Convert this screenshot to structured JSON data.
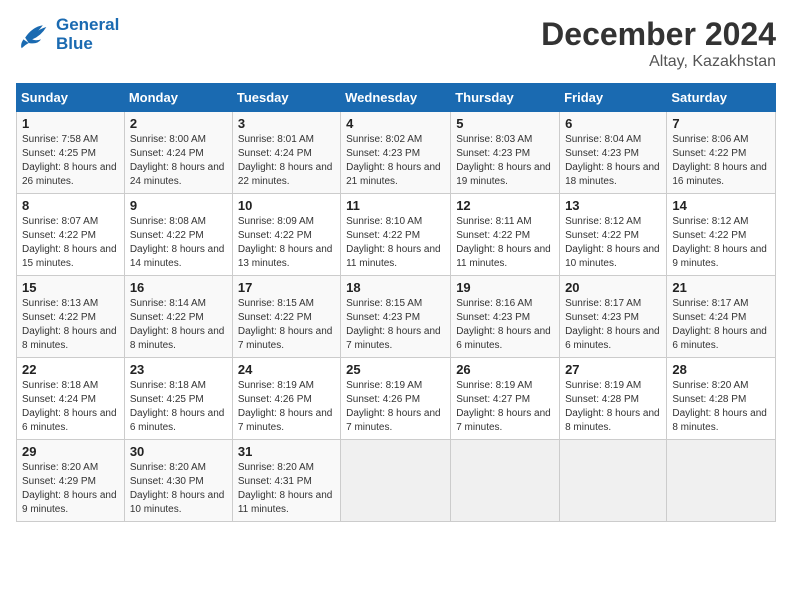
{
  "header": {
    "logo_line1": "General",
    "logo_line2": "Blue",
    "month": "December 2024",
    "location": "Altay, Kazakhstan"
  },
  "weekdays": [
    "Sunday",
    "Monday",
    "Tuesday",
    "Wednesday",
    "Thursday",
    "Friday",
    "Saturday"
  ],
  "weeks": [
    [
      {
        "day": "1",
        "info": "Sunrise: 7:58 AM\nSunset: 4:25 PM\nDaylight: 8 hours and 26 minutes."
      },
      {
        "day": "2",
        "info": "Sunrise: 8:00 AM\nSunset: 4:24 PM\nDaylight: 8 hours and 24 minutes."
      },
      {
        "day": "3",
        "info": "Sunrise: 8:01 AM\nSunset: 4:24 PM\nDaylight: 8 hours and 22 minutes."
      },
      {
        "day": "4",
        "info": "Sunrise: 8:02 AM\nSunset: 4:23 PM\nDaylight: 8 hours and 21 minutes."
      },
      {
        "day": "5",
        "info": "Sunrise: 8:03 AM\nSunset: 4:23 PM\nDaylight: 8 hours and 19 minutes."
      },
      {
        "day": "6",
        "info": "Sunrise: 8:04 AM\nSunset: 4:23 PM\nDaylight: 8 hours and 18 minutes."
      },
      {
        "day": "7",
        "info": "Sunrise: 8:06 AM\nSunset: 4:22 PM\nDaylight: 8 hours and 16 minutes."
      }
    ],
    [
      {
        "day": "8",
        "info": "Sunrise: 8:07 AM\nSunset: 4:22 PM\nDaylight: 8 hours and 15 minutes."
      },
      {
        "day": "9",
        "info": "Sunrise: 8:08 AM\nSunset: 4:22 PM\nDaylight: 8 hours and 14 minutes."
      },
      {
        "day": "10",
        "info": "Sunrise: 8:09 AM\nSunset: 4:22 PM\nDaylight: 8 hours and 13 minutes."
      },
      {
        "day": "11",
        "info": "Sunrise: 8:10 AM\nSunset: 4:22 PM\nDaylight: 8 hours and 11 minutes."
      },
      {
        "day": "12",
        "info": "Sunrise: 8:11 AM\nSunset: 4:22 PM\nDaylight: 8 hours and 11 minutes."
      },
      {
        "day": "13",
        "info": "Sunrise: 8:12 AM\nSunset: 4:22 PM\nDaylight: 8 hours and 10 minutes."
      },
      {
        "day": "14",
        "info": "Sunrise: 8:12 AM\nSunset: 4:22 PM\nDaylight: 8 hours and 9 minutes."
      }
    ],
    [
      {
        "day": "15",
        "info": "Sunrise: 8:13 AM\nSunset: 4:22 PM\nDaylight: 8 hours and 8 minutes."
      },
      {
        "day": "16",
        "info": "Sunrise: 8:14 AM\nSunset: 4:22 PM\nDaylight: 8 hours and 8 minutes."
      },
      {
        "day": "17",
        "info": "Sunrise: 8:15 AM\nSunset: 4:22 PM\nDaylight: 8 hours and 7 minutes."
      },
      {
        "day": "18",
        "info": "Sunrise: 8:15 AM\nSunset: 4:23 PM\nDaylight: 8 hours and 7 minutes."
      },
      {
        "day": "19",
        "info": "Sunrise: 8:16 AM\nSunset: 4:23 PM\nDaylight: 8 hours and 6 minutes."
      },
      {
        "day": "20",
        "info": "Sunrise: 8:17 AM\nSunset: 4:23 PM\nDaylight: 8 hours and 6 minutes."
      },
      {
        "day": "21",
        "info": "Sunrise: 8:17 AM\nSunset: 4:24 PM\nDaylight: 8 hours and 6 minutes."
      }
    ],
    [
      {
        "day": "22",
        "info": "Sunrise: 8:18 AM\nSunset: 4:24 PM\nDaylight: 8 hours and 6 minutes."
      },
      {
        "day": "23",
        "info": "Sunrise: 8:18 AM\nSunset: 4:25 PM\nDaylight: 8 hours and 6 minutes."
      },
      {
        "day": "24",
        "info": "Sunrise: 8:19 AM\nSunset: 4:26 PM\nDaylight: 8 hours and 7 minutes."
      },
      {
        "day": "25",
        "info": "Sunrise: 8:19 AM\nSunset: 4:26 PM\nDaylight: 8 hours and 7 minutes."
      },
      {
        "day": "26",
        "info": "Sunrise: 8:19 AM\nSunset: 4:27 PM\nDaylight: 8 hours and 7 minutes."
      },
      {
        "day": "27",
        "info": "Sunrise: 8:19 AM\nSunset: 4:28 PM\nDaylight: 8 hours and 8 minutes."
      },
      {
        "day": "28",
        "info": "Sunrise: 8:20 AM\nSunset: 4:28 PM\nDaylight: 8 hours and 8 minutes."
      }
    ],
    [
      {
        "day": "29",
        "info": "Sunrise: 8:20 AM\nSunset: 4:29 PM\nDaylight: 8 hours and 9 minutes."
      },
      {
        "day": "30",
        "info": "Sunrise: 8:20 AM\nSunset: 4:30 PM\nDaylight: 8 hours and 10 minutes."
      },
      {
        "day": "31",
        "info": "Sunrise: 8:20 AM\nSunset: 4:31 PM\nDaylight: 8 hours and 11 minutes."
      },
      null,
      null,
      null,
      null
    ]
  ]
}
